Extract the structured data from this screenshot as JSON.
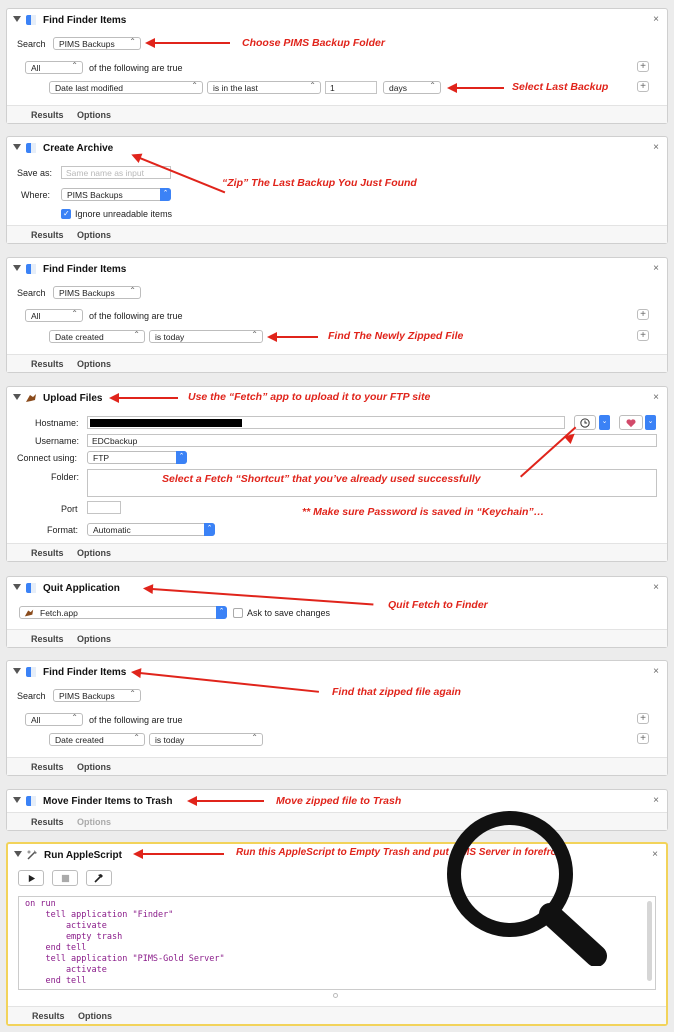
{
  "close_glyph": "×",
  "results_label": "Results",
  "options_label": "Options",
  "plus_glyph": "+",
  "card1": {
    "title": "Find Finder Items",
    "search_label": "Search",
    "search_value": "PIMS Backups",
    "match_value": "All",
    "match_text": "of the following are true",
    "cond_field": "Date last modified",
    "cond_op": "is in the last",
    "cond_num": "1",
    "cond_unit": "days",
    "note1": "Choose PIMS Backup Folder",
    "note2": "Select Last Backup"
  },
  "card2": {
    "title": "Create Archive",
    "save_as_label": "Save as:",
    "save_as_placeholder": "Same name as input",
    "where_label": "Where:",
    "where_value": "PIMS Backups",
    "ignore_label": "Ignore unreadable items",
    "note": "“Zip” The Last Backup You Just Found"
  },
  "card3": {
    "title": "Find Finder Items",
    "search_label": "Search",
    "search_value": "PIMS Backups",
    "match_value": "All",
    "match_text": "of the following are true",
    "cond_field": "Date created",
    "cond_op": "is today",
    "note": "Find The Newly Zipped File"
  },
  "card4": {
    "title": "Upload Files",
    "hostname_label": "Hostname:",
    "username_label": "Username:",
    "username_value": "EDCbackup",
    "connect_label": "Connect using:",
    "connect_value": "FTP",
    "folder_label": "Folder:",
    "port_label": "Port",
    "format_label": "Format:",
    "format_value": "Automatic",
    "note_title": "Use the “Fetch” app to upload it to your FTP site",
    "note_shortcut": "Select a Fetch “Shortcut” that you’ve already used successfully",
    "note_password": "** Make sure Password is saved in “Keychain”…"
  },
  "card5": {
    "title": "Quit Application",
    "app_value": "Fetch.app",
    "ask_label": "Ask to save changes",
    "note": "Quit Fetch to Finder"
  },
  "card6": {
    "title": "Find Finder Items",
    "search_label": "Search",
    "search_value": "PIMS Backups",
    "match_value": "All",
    "match_text": "of the following are true",
    "cond_field": "Date created",
    "cond_op": "is today",
    "note": "Find that zipped file again"
  },
  "card7": {
    "title": "Move Finder Items to Trash",
    "note": "Move zipped file to Trash"
  },
  "card8": {
    "title": "Run AppleScript",
    "note": "Run this AppleScript to Empty Trash and put PIMS Server in forefront",
    "code": [
      "on run",
      "    tell application \"Finder\"",
      "        activate",
      "        empty trash",
      "    end tell",
      "    tell application \"PIMS-Gold Server\"",
      "        activate",
      "    end tell"
    ]
  },
  "colors": {
    "annotation": "#e0241b",
    "highlight_border": "#f2d35a",
    "accent": "#3b82f6"
  },
  "icons": [
    "finder-icon",
    "fetch-icon",
    "applescript-icon",
    "magnifier-icon",
    "play-icon",
    "stop-icon",
    "hammer-icon",
    "clock-icon",
    "heart-icon"
  ]
}
